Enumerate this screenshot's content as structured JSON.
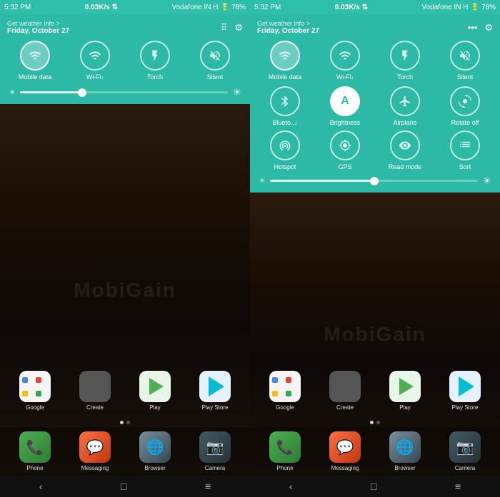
{
  "left_panel": {
    "status_bar": {
      "time": "5:32 PM",
      "network_speed": "0.03K/s",
      "carrier": "Vodafone IN H",
      "battery": "78%"
    },
    "quick_panel": {
      "weather_text": "Get weather info >",
      "date": "Friday, October 27",
      "toggles": [
        {
          "id": "mobile-data",
          "label": "Mobile data",
          "active": true,
          "icon": "📶"
        },
        {
          "id": "wifi",
          "label": "Wi-Fi↓",
          "active": false,
          "icon": "📡"
        },
        {
          "id": "torch",
          "label": "Torch",
          "active": false,
          "icon": "🔦"
        },
        {
          "id": "silent",
          "label": "Silent",
          "active": false,
          "icon": "🔕"
        }
      ],
      "slider_pct": 30
    },
    "home": {
      "app_rows": [
        [
          {
            "label": "Google",
            "icon_type": "google"
          },
          {
            "label": "Create",
            "icon_type": "create"
          },
          {
            "label": "Play",
            "icon_type": "play"
          },
          {
            "label": "Play Store",
            "icon_type": "playstore"
          }
        ]
      ],
      "dock": [
        {
          "label": "Phone",
          "icon_type": "phone"
        },
        {
          "label": "Messaging",
          "icon_type": "messaging"
        },
        {
          "label": "Browser",
          "icon_type": "browser"
        },
        {
          "label": "Camera",
          "icon_type": "camera"
        }
      ]
    },
    "nav": [
      "‹",
      "□",
      "≡"
    ]
  },
  "right_panel": {
    "status_bar": {
      "time": "5:32 PM",
      "network_speed": "0.03K/s",
      "carrier": "Vodafone IN H",
      "battery": "78%"
    },
    "quick_panel": {
      "weather_text": "Get weather info >",
      "date": "Friday, October 27",
      "toggles_row1": [
        {
          "id": "mobile-data",
          "label": "Mobile data",
          "active": true,
          "icon": "📶"
        },
        {
          "id": "wifi",
          "label": "Wi-Fi↓",
          "active": false,
          "icon": "📡"
        },
        {
          "id": "torch",
          "label": "Torch",
          "active": false,
          "icon": "🔦"
        },
        {
          "id": "silent",
          "label": "Silent",
          "active": false,
          "icon": "🔕"
        }
      ],
      "toggles_row2": [
        {
          "id": "bluetooth",
          "label": "Blueto..↓",
          "active": false,
          "icon": "₿"
        },
        {
          "id": "brightness",
          "label": "Brightness",
          "active": true,
          "icon": "A"
        },
        {
          "id": "airplane",
          "label": "Airplane",
          "active": false,
          "icon": "✈"
        },
        {
          "id": "rotate",
          "label": "Rotate off",
          "active": false,
          "icon": "🔄"
        }
      ],
      "toggles_row3": [
        {
          "id": "hotspot",
          "label": "Hotspot",
          "icon": "📶"
        },
        {
          "id": "gps",
          "label": "GPS",
          "icon": "⊙"
        },
        {
          "id": "readmode",
          "label": "Read mode",
          "icon": "👁"
        },
        {
          "id": "sort",
          "label": "Sort",
          "icon": "⊞"
        }
      ],
      "slider_pct": 50,
      "header_icons": [
        "•••",
        "⚙"
      ]
    },
    "home": {
      "app_rows": [
        [
          {
            "label": "Google",
            "icon_type": "google"
          },
          {
            "label": "Create",
            "icon_type": "create"
          },
          {
            "label": "Play",
            "icon_type": "play"
          },
          {
            "label": "Play Store",
            "icon_type": "playstore"
          }
        ]
      ],
      "dock": [
        {
          "label": "Phone",
          "icon_type": "phone"
        },
        {
          "label": "Messaging",
          "icon_type": "messaging"
        },
        {
          "label": "Browser",
          "icon_type": "browser"
        },
        {
          "label": "Camera",
          "icon_type": "camera"
        }
      ]
    },
    "nav": [
      "‹",
      "□",
      "≡"
    ]
  },
  "icons": {
    "grid": "⠿",
    "gear": "⚙",
    "dots": "•••",
    "chevron": "›"
  }
}
